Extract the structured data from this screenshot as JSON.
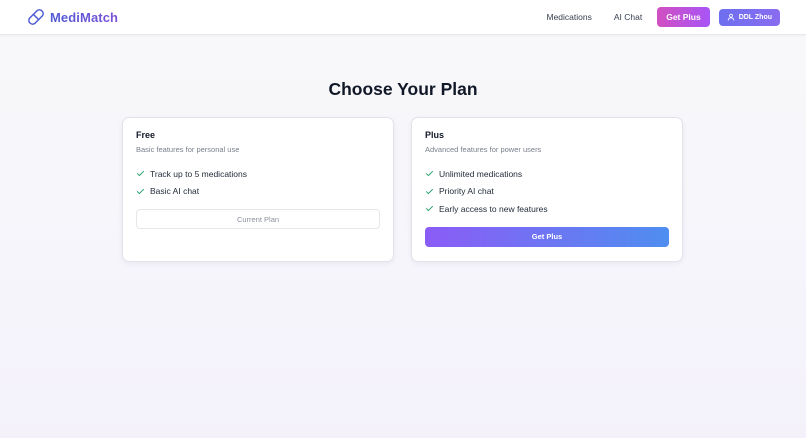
{
  "nav": {
    "brand": "MediMatch",
    "links": [
      "Medications",
      "AI Chat"
    ],
    "get_plus_label": "Get Plus",
    "user_label": "DDL Zhou"
  },
  "title": "Choose Your Plan",
  "plans": [
    {
      "name": "Free",
      "description": "Basic features for personal use",
      "features": [
        "Track up to 5 medications",
        "Basic AI chat"
      ],
      "button_label": "Current Plan"
    },
    {
      "name": "Plus",
      "description": "Advanced features for power users",
      "features": [
        "Unlimited medications",
        "Priority AI chat",
        "Early access to new features"
      ],
      "button_label": "Get Plus"
    }
  ],
  "icons": {
    "logo": "pill-icon",
    "user": "user-icon",
    "check": "check-icon"
  },
  "colors": {
    "brand_gradient": [
      "#4f5bd5",
      "#7b4fd6"
    ],
    "get_plus_nav": [
      "#d14fc1",
      "#a855f7"
    ],
    "user_button": [
      "#6d6ff0",
      "#8a6cf0"
    ],
    "plus_button": [
      "#8b5cf6",
      "#4f8ef0"
    ],
    "check": "#22a06b"
  }
}
